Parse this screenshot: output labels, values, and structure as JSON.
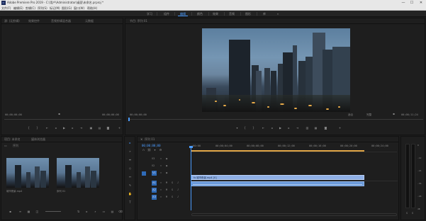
{
  "window": {
    "title": "Adobe Premiere Pro 2019 - C:\\用户\\Administrator\\桌面\\未命名.prproj *",
    "minimize": "—",
    "maximize": "☐",
    "close": "✕"
  },
  "menu": [
    "文件(F)",
    "编辑(E)",
    "剪辑(C)",
    "序列(S)",
    "标记(M)",
    "图形(G)",
    "窗口(W)",
    "帮助(H)"
  ],
  "workspace": {
    "tabs": [
      "学习",
      "组件",
      "编辑",
      "颜色",
      "效果",
      "音频",
      "图形",
      "库"
    ],
    "active_index": 2,
    "overflow": "»"
  },
  "source_panel": {
    "tabs": [
      "源: (无剪辑)",
      "效果控件",
      "音频剪辑混合器",
      "元数据"
    ],
    "timecode_left": "00;00;00;00",
    "timecode_right": "00;00;00;00"
  },
  "program_panel": {
    "title": "节目: 序列 01",
    "timecode_left": "00;00;00;00",
    "fit": "适合",
    "quality": "完整",
    "timecode_right": "00;00;11;24"
  },
  "project_panel": {
    "tabs": [
      "项目: 未命名",
      "媒体浏览器"
    ],
    "item_label": "序列",
    "thumbnails": [
      {
        "name": "城市夜景.mp4"
      },
      {
        "name": "序列 01"
      }
    ]
  },
  "timeline_panel": {
    "title": "序列 01",
    "timecode": "00;00;00;00",
    "ruler_ticks": [
      ":00:00",
      "00;00;04;00",
      "00;00;08;00",
      "00;00;12;00",
      "00;00;16;00",
      "00;00;20;00",
      "00;00;24;00"
    ],
    "tracks": {
      "video": [
        "V3",
        "V2",
        "V1"
      ],
      "audio": [
        "A1",
        "A2",
        "A3"
      ]
    },
    "video_clip_label": "fx 城市夜景.mp4 [V]",
    "playhead_fraction": 0.0
  },
  "meter": {
    "scale": [
      "0",
      "-12",
      "-24",
      "-36",
      "-48",
      "dB"
    ],
    "solo": "S"
  },
  "colors": {
    "accent": "#4b9cff",
    "clip_video": "#8fb0e6",
    "clip_audio": "#6b9ad9",
    "work_area": "#e0a546"
  }
}
